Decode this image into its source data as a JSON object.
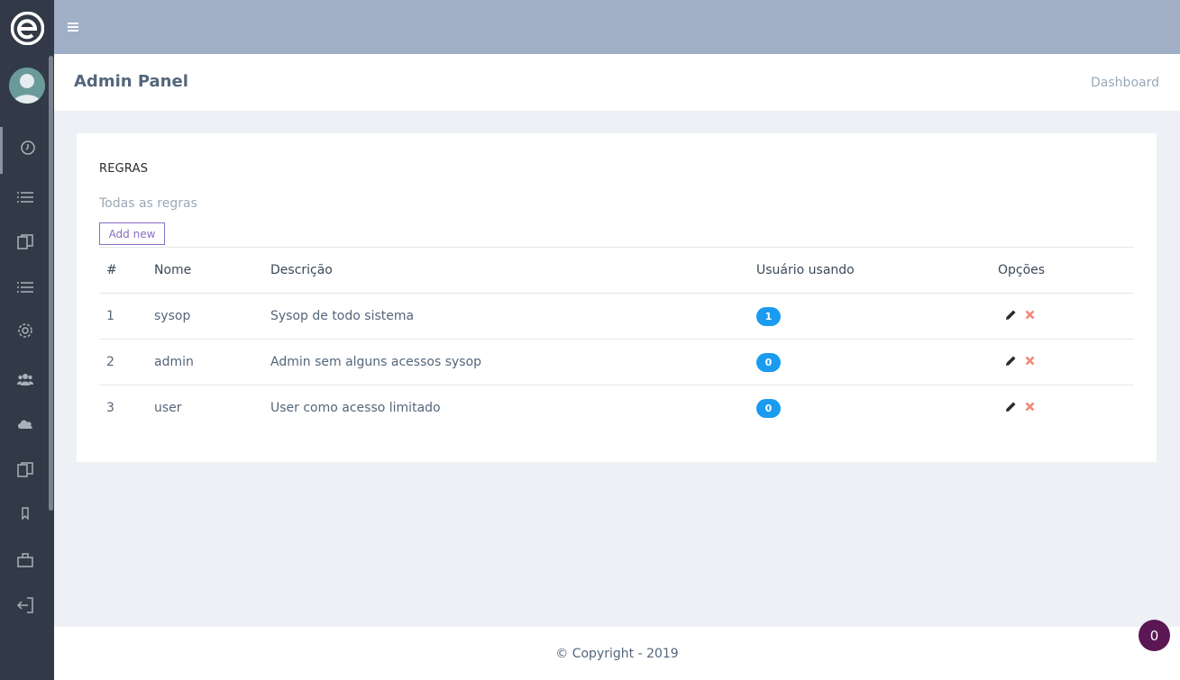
{
  "header": {
    "page_title": "Admin Panel",
    "breadcrumb": "Dashboard"
  },
  "sidebar": {
    "icons": [
      "clock-icon",
      "list-icon",
      "copy-icon",
      "list-icon",
      "gear-icon",
      "users-icon",
      "cloud-icon",
      "copy-icon",
      "bookmark-icon",
      "briefcase-icon",
      "logout-icon"
    ]
  },
  "card": {
    "title": "REGRAS",
    "subtitle": "Todas as regras",
    "add_button": "Add new",
    "columns": [
      "#",
      "Nome",
      "Descrição",
      "Usuário usando",
      "Opções"
    ],
    "rows": [
      {
        "id": "1",
        "name": "sysop",
        "description": "Sysop de todo sistema",
        "users": "1"
      },
      {
        "id": "2",
        "name": "admin",
        "description": "Admin sem alguns acessos sysop",
        "users": "0"
      },
      {
        "id": "3",
        "name": "user",
        "description": "User como acesso limitado",
        "users": "0"
      }
    ]
  },
  "footer": {
    "copyright": "© Copyright - 2019"
  },
  "floating_badge": "0",
  "colors": {
    "sidebar": "#313a46",
    "topbar": "#a0afc6",
    "badge": "#1a9bf0",
    "delete": "#f08a7a",
    "add_button_border": "#8a6ec6",
    "floating_badge": "#5a1754"
  }
}
